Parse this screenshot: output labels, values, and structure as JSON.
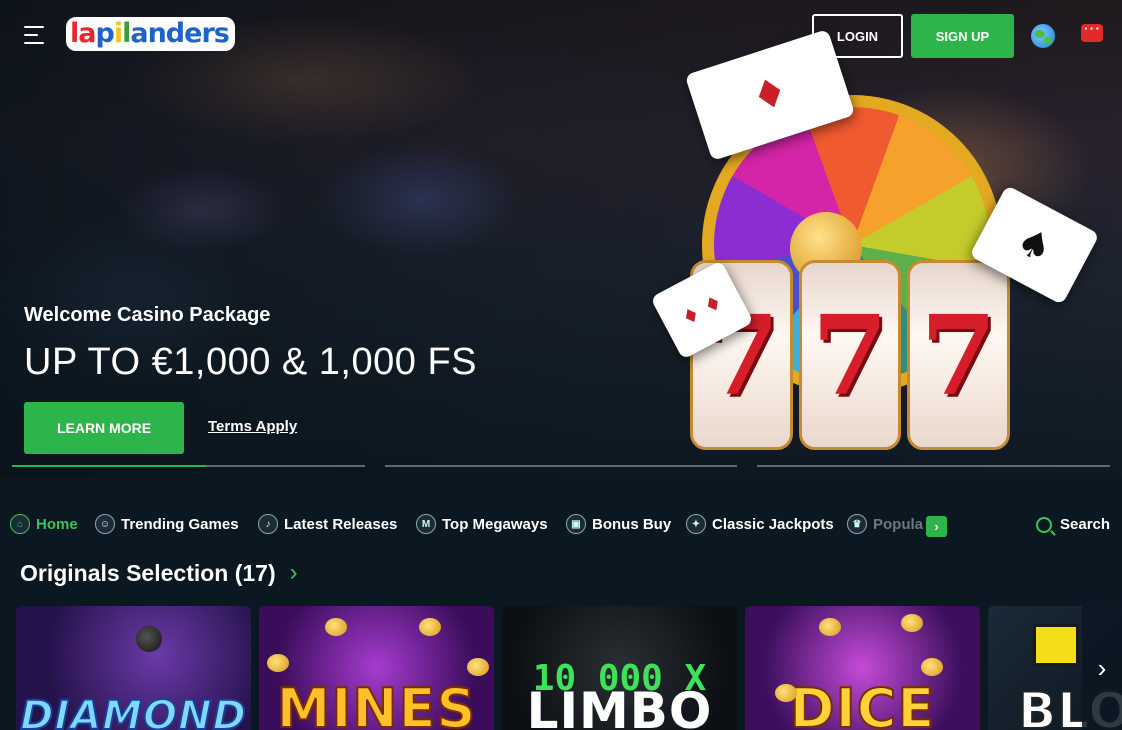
{
  "header": {
    "logo_text": "lapilanders",
    "login_label": "LOGIN",
    "signup_label": "SIGN UP"
  },
  "hero": {
    "subtitle": "Welcome Casino Package",
    "title": "UP TO €1,000 & 1,000 FS",
    "cta_label": "LEARN MORE",
    "terms_label": "Terms Apply",
    "slide_progress": [
      1,
      0,
      0
    ],
    "active_slide_fill": 0.55,
    "art": {
      "reel_symbols": [
        "7",
        "7",
        "7"
      ],
      "card1": "♦",
      "card2": "♠",
      "card3": "♦ ♦"
    }
  },
  "categories": {
    "items": [
      {
        "label": "Home",
        "icon": "home-icon",
        "active": true
      },
      {
        "label": "Trending Games",
        "icon": "trending-icon",
        "active": false
      },
      {
        "label": "Latest Releases",
        "icon": "bell-icon",
        "active": false
      },
      {
        "label": "Top Megaways",
        "icon": "megaways-icon",
        "active": false
      },
      {
        "label": "Bonus Buy",
        "icon": "bonus-icon",
        "active": false
      },
      {
        "label": "Classic Jackpots",
        "icon": "jackpot-icon",
        "active": false
      },
      {
        "label": "Popula",
        "icon": "popular-icon",
        "active": false
      }
    ],
    "search_label": "Search"
  },
  "originals": {
    "title": "Originals Selection (17)",
    "games": [
      {
        "name": "DIAMOND"
      },
      {
        "name": "MINES"
      },
      {
        "name": "LIMBO",
        "top": "10 000 X"
      },
      {
        "name": "DICE"
      },
      {
        "name": "BLO"
      }
    ]
  },
  "colors": {
    "accent": "#2db54b",
    "background": "#0b1822"
  }
}
